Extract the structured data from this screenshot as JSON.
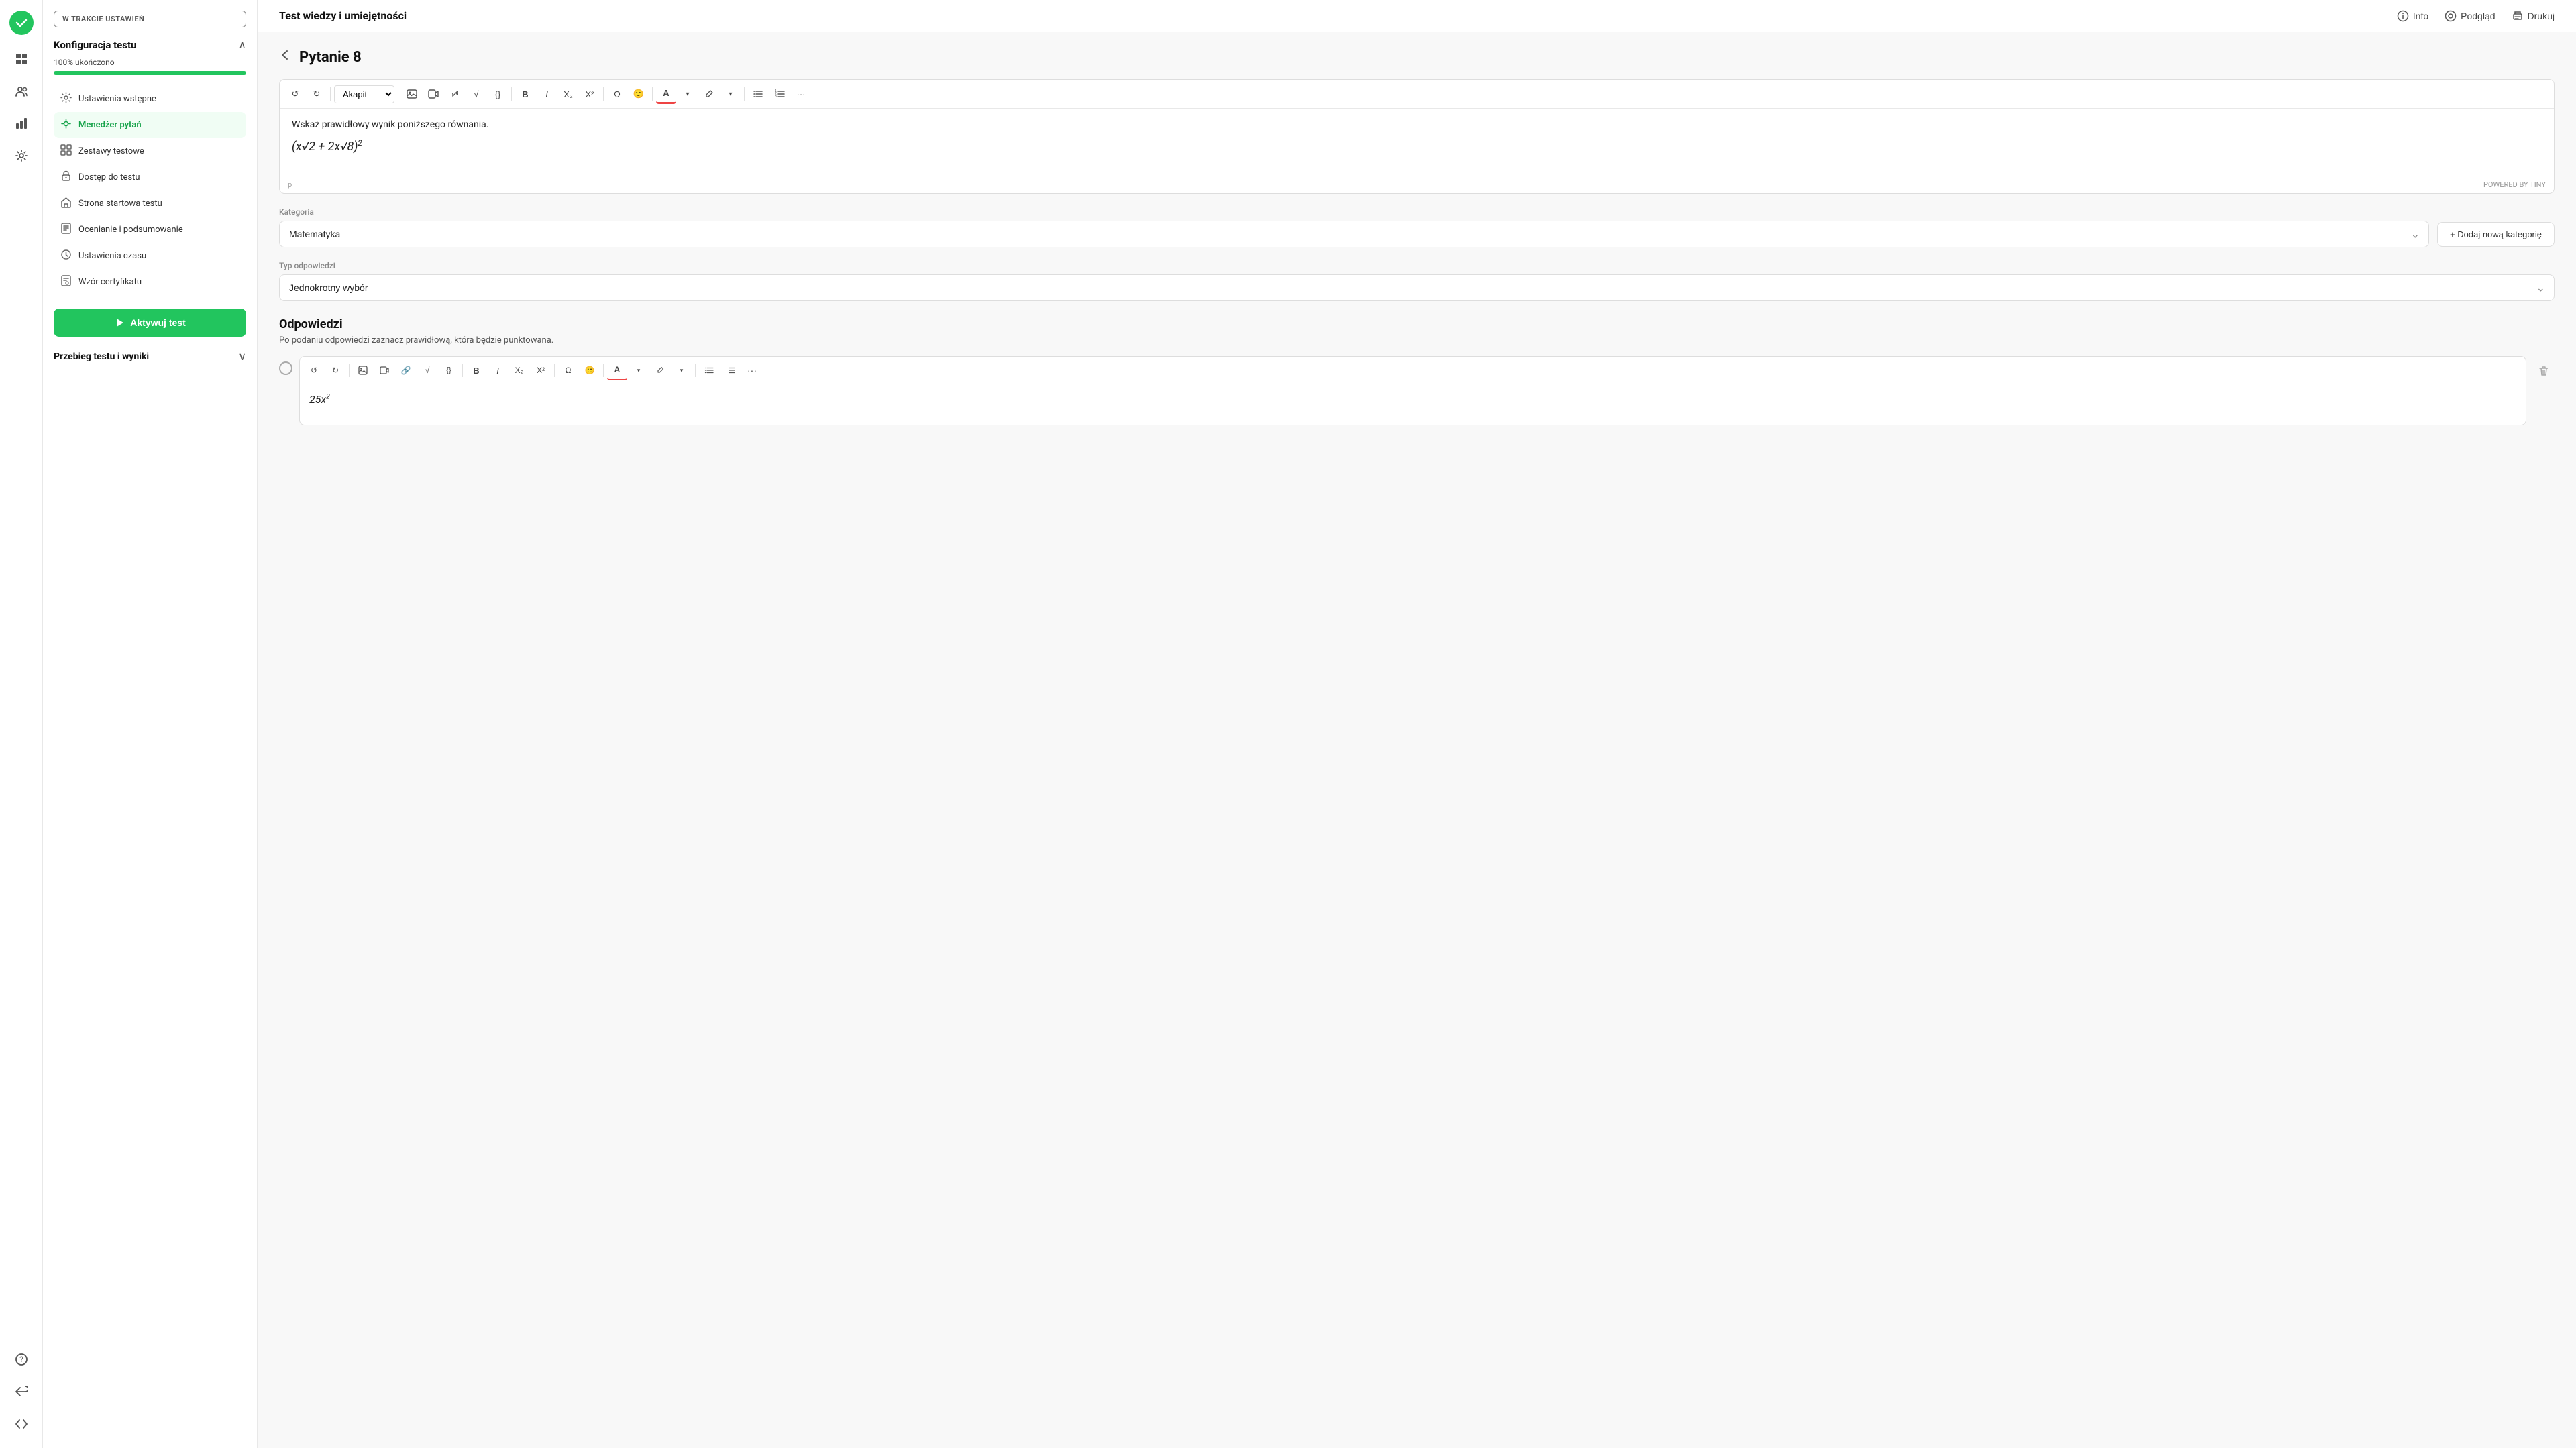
{
  "app": {
    "title": "Test wiedzy i umiejętności",
    "status_badge": "W TRAKCIE USTAWIEŃ"
  },
  "top_actions": {
    "info_label": "Info",
    "preview_label": "Podgląd",
    "print_label": "Drukuj"
  },
  "left_panel": {
    "config_title": "Konfiguracja testu",
    "progress_label": "100% ukończono",
    "progress_value": 100,
    "nav_items": [
      {
        "id": "initial-settings",
        "label": "Ustawienia wstępne",
        "icon": "⚙"
      },
      {
        "id": "question-manager",
        "label": "Menedżer pytań",
        "icon": "≡",
        "active": true
      },
      {
        "id": "test-sets",
        "label": "Zestawy testowe",
        "icon": "⊞"
      },
      {
        "id": "test-access",
        "label": "Dostęp do testu",
        "icon": "🔒"
      },
      {
        "id": "start-page",
        "label": "Strona startowa testu",
        "icon": "🏠"
      },
      {
        "id": "grading",
        "label": "Ocenianie i podsumowanie",
        "icon": "📋"
      },
      {
        "id": "time-settings",
        "label": "Ustawienia czasu",
        "icon": "🕐"
      },
      {
        "id": "certificate",
        "label": "Wzór certyfikatu",
        "icon": "📄"
      }
    ],
    "activate_btn_label": "Aktywuj test",
    "results_title": "Przebieg testu i wyniki"
  },
  "question": {
    "back_label": "‹",
    "title": "Pytanie 8",
    "content_text": "Wskaż prawidłowy wynik poniższego równania.",
    "formula": "(x√2 + 2x√8)²",
    "powered_by": "POWERED BY TINY",
    "category_label": "Kategoria",
    "category_value": "Matematyka",
    "add_category_label": "+ Dodaj nową kategorię",
    "answer_type_label": "Typ odpowiedzi",
    "answer_type_value": "Jednokrotny wybór",
    "answers_title": "Odpowiedzi",
    "answers_hint": "Po podaniu odpowiedzi zaznacz prawidłową, która będzie punktowana.",
    "answer_value": "25x²",
    "p_label": "p"
  },
  "toolbar": {
    "style_select": "Akapit",
    "buttons": [
      "↺",
      "↻",
      "🖼",
      "▶",
      "🔗",
      "√",
      "{}",
      "B",
      "I",
      "X₂",
      "X²",
      "Ω",
      "🙂",
      "A",
      "🖍",
      "≡",
      "≡",
      "..."
    ]
  }
}
